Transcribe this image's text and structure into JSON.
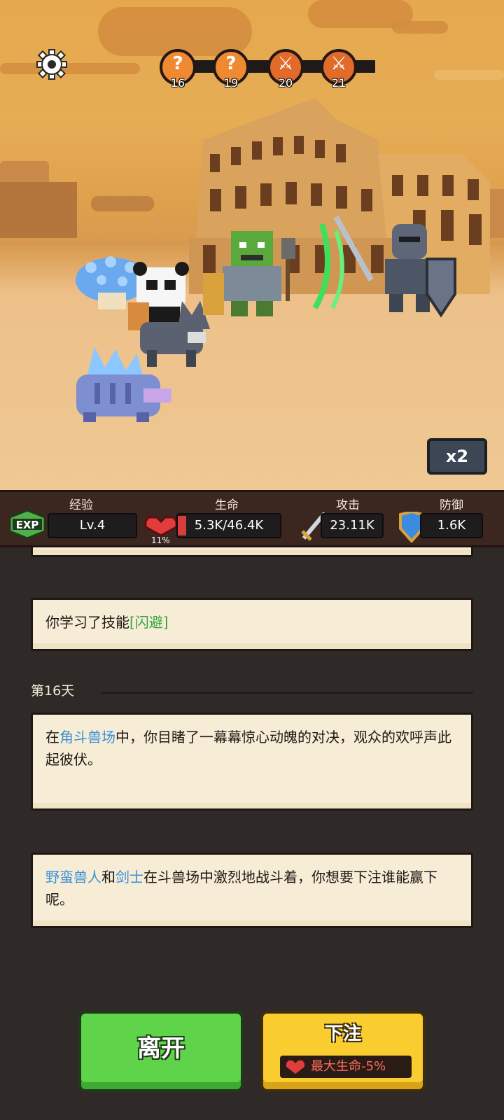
{
  "progress": {
    "nodes": [
      {
        "day": "16",
        "state": "unknown",
        "glyph": "?"
      },
      {
        "day": "19",
        "state": "unknown",
        "glyph": "?"
      },
      {
        "day": "20",
        "state": "battle",
        "glyph": "⚔"
      },
      {
        "day": "21",
        "state": "battle",
        "glyph": "⚔"
      }
    ]
  },
  "speed_button": "x2",
  "stats": {
    "exp": {
      "label": "经验",
      "badge": "EXP",
      "value": "Lv.4"
    },
    "hp": {
      "label": "生命",
      "value": "5.3K/46.4K",
      "percent": "11%"
    },
    "atk": {
      "label": "攻击",
      "value": "23.11K"
    },
    "def": {
      "label": "防御",
      "value": "1.6K"
    }
  },
  "log": {
    "skill_card": {
      "text": "你学习了技能",
      "skill": "[闪避]"
    },
    "day_heading": "第16天",
    "event_card": {
      "p1": "在",
      "place": "角斗兽场",
      "p2": "中，你目睹了一幕幕惊心动魄的对决，观众的欢呼声此起彼伏。"
    },
    "bet_card": {
      "name1": "野蛮兽人",
      "and": "和",
      "name2": "剑士",
      "rest": "在斗兽场中激烈地战斗着，你想要下注谁能赢下呢。"
    }
  },
  "buttons": {
    "leave": "离开",
    "bet": "下注",
    "bet_cost": "最大生命-5%"
  },
  "colors": {
    "accent_blue": "#3a8fd6",
    "accent_green": "#2ea640",
    "leave_green": "#5fd34a",
    "bet_yellow": "#f9cc2f"
  }
}
